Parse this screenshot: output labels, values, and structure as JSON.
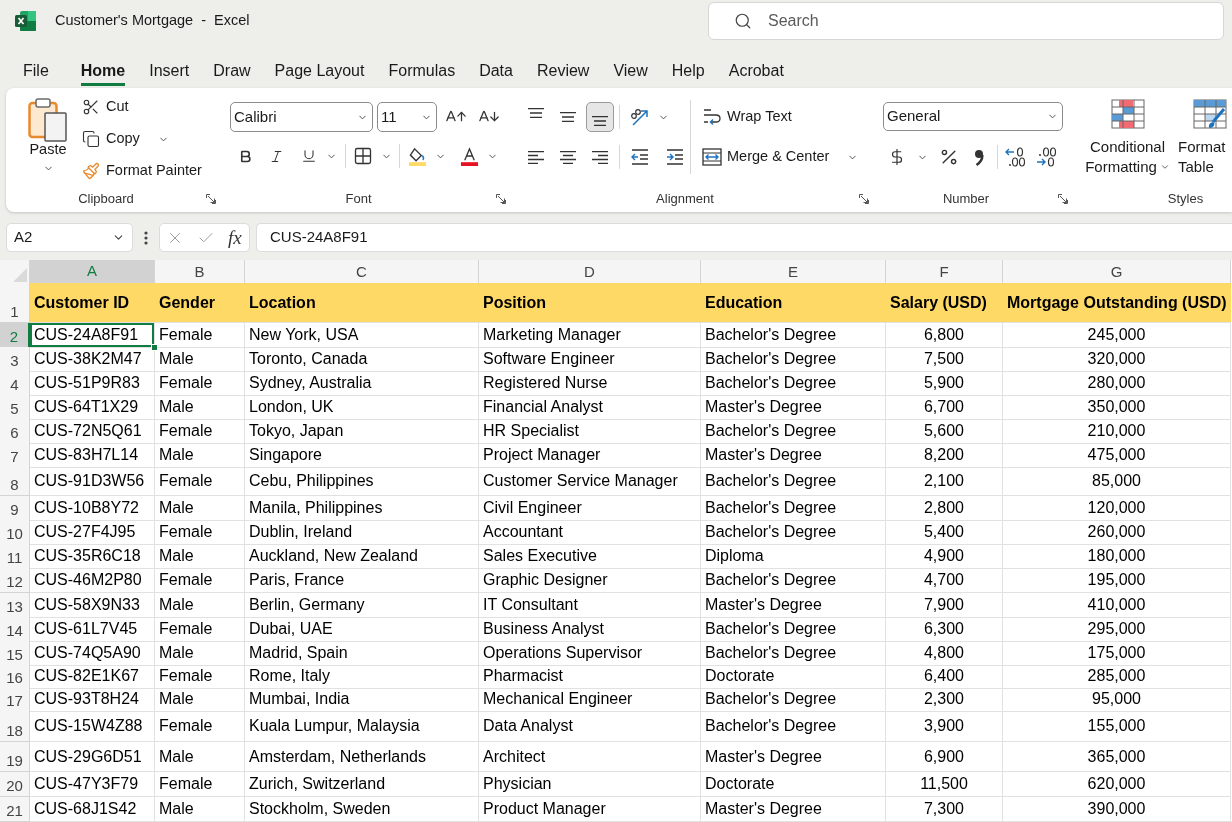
{
  "window": {
    "title": "Customer's Mortgage  -  Excel"
  },
  "search": {
    "placeholder": "Search"
  },
  "ribbon_tabs": [
    {
      "label": "File",
      "selected": false
    },
    {
      "label": "Home",
      "selected": true
    },
    {
      "label": "Insert",
      "selected": false
    },
    {
      "label": "Draw",
      "selected": false
    },
    {
      "label": "Page Layout",
      "selected": false
    },
    {
      "label": "Formulas",
      "selected": false
    },
    {
      "label": "Data",
      "selected": false
    },
    {
      "label": "Review",
      "selected": false
    },
    {
      "label": "View",
      "selected": false
    },
    {
      "label": "Help",
      "selected": false
    },
    {
      "label": "Acrobat",
      "selected": false
    }
  ],
  "clipboard": {
    "label": "Clipboard",
    "paste": "Paste",
    "cut": "Cut",
    "copy": "Copy",
    "format_painter": "Format Painter"
  },
  "font": {
    "label": "Font",
    "font_name": "Calibri",
    "font_size": "11"
  },
  "alignment": {
    "label": "Alignment",
    "vertical_align": [
      {
        "kind": "top",
        "selected": false
      },
      {
        "kind": "middle",
        "selected": false
      },
      {
        "kind": "bottom",
        "selected": true
      }
    ],
    "wrap_text": "Wrap Text",
    "merge_center": "Merge & Center"
  },
  "number": {
    "label": "Number",
    "format": "General"
  },
  "styles": {
    "label": "Styles",
    "conditional_formatting": [
      "Conditional",
      "Formatting"
    ],
    "format_table": [
      "Format",
      "Table"
    ]
  },
  "formula_bar": {
    "name_box": "A2",
    "function_label": "fx",
    "formula": "CUS-24A8F91"
  },
  "sheet": {
    "columns": [
      {
        "letter": "A",
        "selected": true,
        "kind": "text"
      },
      {
        "letter": "B",
        "selected": false,
        "kind": "text"
      },
      {
        "letter": "C",
        "selected": false,
        "kind": "text"
      },
      {
        "letter": "D",
        "selected": false,
        "kind": "text"
      },
      {
        "letter": "E",
        "selected": false,
        "kind": "text"
      },
      {
        "letter": "F",
        "selected": false,
        "kind": "number"
      },
      {
        "letter": "G",
        "selected": false,
        "kind": "number"
      }
    ],
    "header_row": {
      "number": "1",
      "selected": false,
      "cells": [
        "Customer ID",
        "Gender",
        "Location",
        "Position",
        "Education",
        "Salary (USD)",
        "Mortgage Outstanding (USD)"
      ]
    },
    "rows": [
      {
        "number": "2",
        "selected": true,
        "cells": [
          "CUS-24A8F91",
          "Female",
          "New York, USA",
          "Marketing Manager",
          "Bachelor's Degree",
          "6,800",
          "245,000"
        ]
      },
      {
        "number": "3",
        "selected": false,
        "cells": [
          "CUS-38K2M47",
          "Male",
          "Toronto, Canada",
          "Software Engineer",
          "Bachelor's Degree",
          "7,500",
          "320,000"
        ]
      },
      {
        "number": "4",
        "selected": false,
        "cells": [
          "CUS-51P9R83",
          "Female",
          "Sydney, Australia",
          "Registered Nurse",
          "Bachelor's Degree",
          "5,900",
          "280,000"
        ]
      },
      {
        "number": "5",
        "selected": false,
        "cells": [
          "CUS-64T1X29",
          "Male",
          "London, UK",
          "Financial Analyst",
          "Master's Degree",
          "6,700",
          "350,000"
        ]
      },
      {
        "number": "6",
        "selected": false,
        "cells": [
          "CUS-72N5Q61",
          "Female",
          "Tokyo, Japan",
          "HR Specialist",
          "Bachelor's Degree",
          "5,600",
          "210,000"
        ]
      },
      {
        "number": "7",
        "selected": false,
        "cells": [
          "CUS-83H7L14",
          "Male",
          "Singapore",
          "Project Manager",
          "Master's Degree",
          "8,200",
          "475,000"
        ]
      },
      {
        "number": "8",
        "selected": false,
        "cells": [
          "CUS-91D3W56",
          "Female",
          "Cebu, Philippines",
          "Customer Service Manager",
          "Bachelor's Degree",
          "2,100",
          "85,000"
        ]
      },
      {
        "number": "9",
        "selected": false,
        "cells": [
          "CUS-10B8Y72",
          "Male",
          "Manila, Philippines",
          "Civil Engineer",
          "Bachelor's Degree",
          "2,800",
          "120,000"
        ]
      },
      {
        "number": "10",
        "selected": false,
        "cells": [
          "CUS-27F4J95",
          "Female",
          "Dublin, Ireland",
          "Accountant",
          "Bachelor's Degree",
          "5,400",
          "260,000"
        ]
      },
      {
        "number": "11",
        "selected": false,
        "cells": [
          "CUS-35R6C18",
          "Male",
          "Auckland, New Zealand",
          "Sales Executive",
          "Diploma",
          "4,900",
          "180,000"
        ]
      },
      {
        "number": "12",
        "selected": false,
        "cells": [
          "CUS-46M2P80",
          "Female",
          "Paris, France",
          "Graphic Designer",
          "Bachelor's Degree",
          "4,700",
          "195,000"
        ]
      },
      {
        "number": "13",
        "selected": false,
        "cells": [
          "CUS-58X9N33",
          "Male",
          "Berlin, Germany",
          "IT Consultant",
          "Master's Degree",
          "7,900",
          "410,000"
        ]
      },
      {
        "number": "14",
        "selected": false,
        "cells": [
          "CUS-61L7V45",
          "Female",
          "Dubai, UAE",
          "Business Analyst",
          "Bachelor's Degree",
          "6,300",
          "295,000"
        ]
      },
      {
        "number": "15",
        "selected": false,
        "cells": [
          "CUS-74Q5A90",
          "Male",
          "Madrid, Spain",
          "Operations Supervisor",
          "Bachelor's Degree",
          "4,800",
          "175,000"
        ]
      },
      {
        "number": "16",
        "selected": false,
        "cells": [
          "CUS-82E1K67",
          "Female",
          "Rome, Italy",
          "Pharmacist",
          "Doctorate",
          "6,400",
          "285,000"
        ]
      },
      {
        "number": "17",
        "selected": false,
        "cells": [
          "CUS-93T8H24",
          "Male",
          "Mumbai, India",
          "Mechanical Engineer",
          "Bachelor's Degree",
          "2,300",
          "95,000"
        ]
      },
      {
        "number": "18",
        "selected": false,
        "cells": [
          "CUS-15W4Z88",
          "Female",
          "Kuala Lumpur, Malaysia",
          "Data Analyst",
          "Bachelor's Degree",
          "3,900",
          "155,000"
        ]
      },
      {
        "number": "19",
        "selected": false,
        "cells": [
          "CUS-29G6D51",
          "Male",
          "Amsterdam, Netherlands",
          "Architect",
          "Master's Degree",
          "6,900",
          "365,000"
        ]
      },
      {
        "number": "20",
        "selected": false,
        "cells": [
          "CUS-47Y3F79",
          "Female",
          "Zurich, Switzerland",
          "Physician",
          "Doctorate",
          "11,500",
          "620,000"
        ]
      },
      {
        "number": "21",
        "selected": false,
        "cells": [
          "CUS-68J1S42",
          "Male",
          "Stockholm, Sweden",
          "Product Manager",
          "Master's Degree",
          "7,300",
          "390,000"
        ]
      }
    ]
  }
}
